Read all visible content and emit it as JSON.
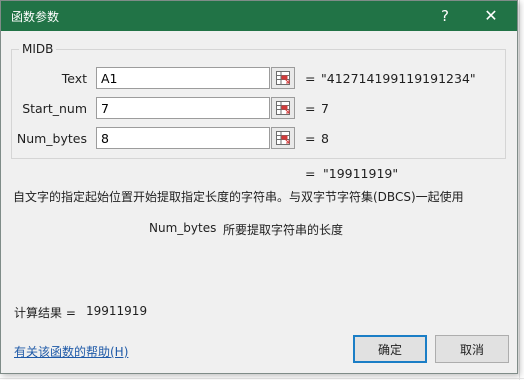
{
  "window": {
    "title": "函数参数",
    "help_glyph": "?",
    "close_glyph": "✕",
    "title_bar_color": "#217346"
  },
  "function": {
    "name": "MIDB",
    "args": [
      {
        "label": "Text",
        "value": "A1",
        "equals": "=",
        "result": "\"412714199119191234\""
      },
      {
        "label": "Start_num",
        "value": "7",
        "equals": "=",
        "result": "7"
      },
      {
        "label": "Num_bytes",
        "value": "8",
        "equals": "=",
        "result": "8"
      }
    ],
    "result_equals": "=",
    "result": "\"19911919\"",
    "description": "自文字的指定起始位置开始提取指定长度的字符串。与双字节字符集(DBCS)一起使用",
    "param_name": "Num_bytes",
    "param_description": "所要提取字符串的长度"
  },
  "footer": {
    "calc_label": "计算结果 =",
    "calc_value": "19911919",
    "help_link": "有关该函数的帮助(H)",
    "ok_label": "确定",
    "cancel_label": "取消"
  },
  "icons": {
    "range_select": "range-select-icon"
  }
}
